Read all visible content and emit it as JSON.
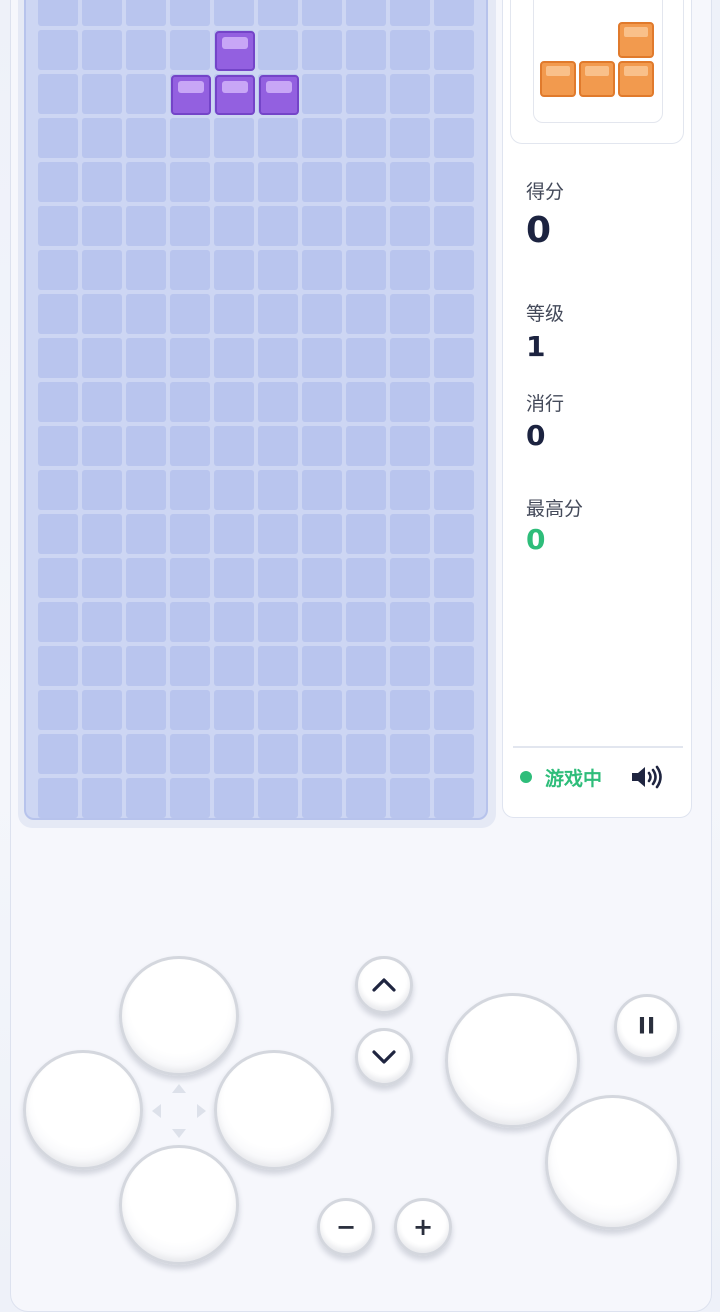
{
  "board": {
    "columns": 10,
    "visible_rows": 19
  },
  "active_piece": {
    "color": "#9360e0",
    "cells": [
      [
        4,
        1
      ],
      [
        3,
        2
      ],
      [
        4,
        2
      ],
      [
        5,
        2
      ]
    ]
  },
  "next_piece": {
    "color": "#f29a4e",
    "cells": [
      [
        2,
        0
      ],
      [
        0,
        1
      ],
      [
        1,
        1
      ],
      [
        2,
        1
      ]
    ]
  },
  "stats": {
    "score_label": "得分",
    "score": "0",
    "level_label": "等级",
    "level": "1",
    "lines_label": "消行",
    "lines": "0",
    "best_label": "最高分",
    "best": "0"
  },
  "status": {
    "text": "游戏中",
    "dot_color": "#2ebd7a",
    "sound_icon": "speaker-icon"
  },
  "controls": {
    "minus_label": "−",
    "plus_label": "+",
    "pause_label": "II",
    "up_icon": "chevron-up-icon",
    "down_icon": "chevron-down-icon"
  },
  "colors": {
    "board_bg": "#cdd6f3",
    "cell": "#b9c5ee",
    "best_score": "#2ebd7a"
  }
}
